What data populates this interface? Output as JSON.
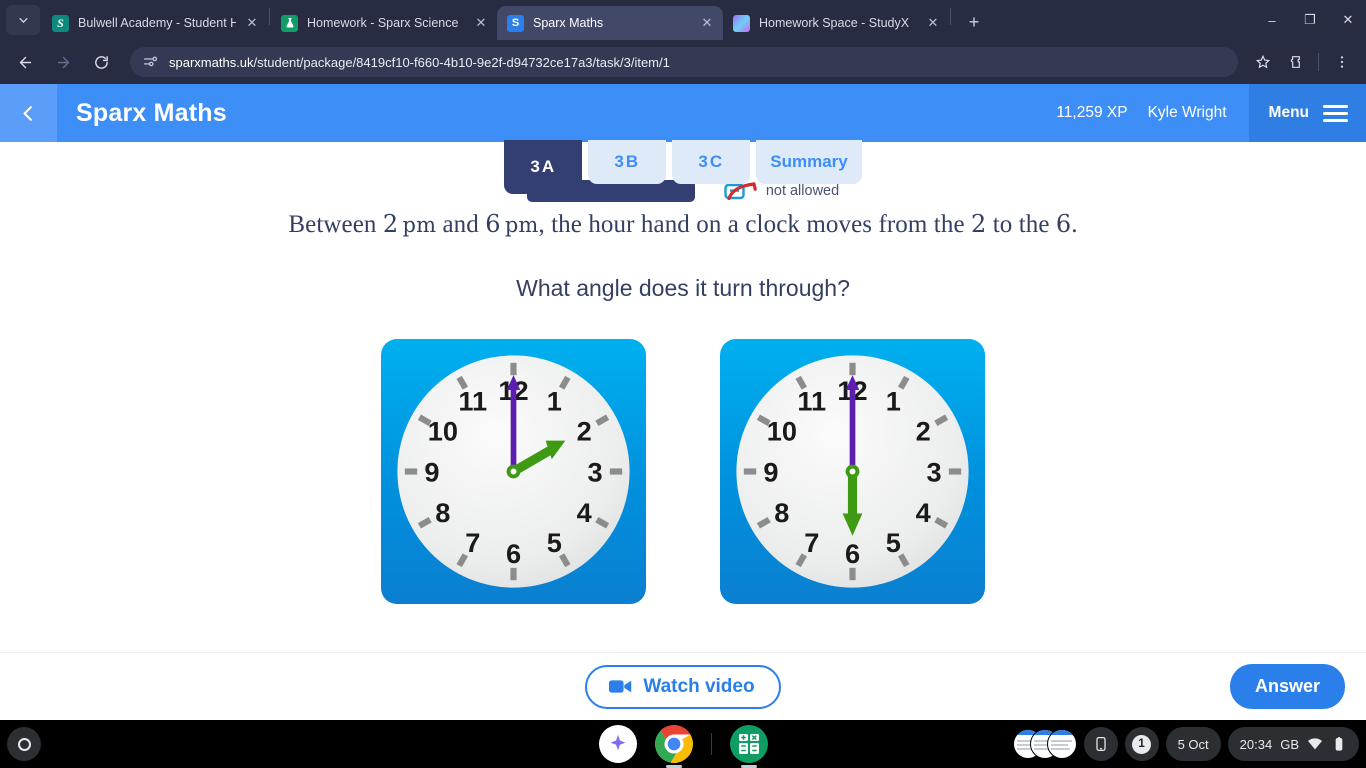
{
  "browser": {
    "tab_list_icon": "chevron-down-icon",
    "tabs": [
      {
        "title": "Bulwell Academy - Student Hom",
        "favicon": "sharepoint-icon",
        "favicon_letter": "S",
        "active": false
      },
      {
        "title": "Homework - Sparx Science",
        "favicon": "flask-icon",
        "favicon_letter": "",
        "active": false
      },
      {
        "title": "Sparx Maths",
        "favicon": "sparx-maths-icon",
        "favicon_letter": "S",
        "active": true
      },
      {
        "title": "Homework Space - StudyX",
        "favicon": "studyx-cube-icon",
        "favicon_letter": "",
        "active": false
      }
    ],
    "new_tab_label": "+",
    "window_controls": {
      "minimize": "–",
      "maximize": "❐",
      "close": "✕"
    },
    "toolbar": {
      "back_icon": "arrow-left-icon",
      "forward_icon": "arrow-right-icon",
      "reload_icon": "reload-icon",
      "site_info_icon": "site-settings-icon",
      "url_host": "sparxmaths.uk",
      "url_path": "/student/package/8419cf10-f660-4b10-9e2f-d94732ce17a3/task/3/item/1",
      "bookmark_icon": "star-icon",
      "extensions_icon": "puzzle-piece-icon",
      "menu_icon": "three-dot-menu-icon"
    }
  },
  "sparx": {
    "back_icon": "chevron-left-icon",
    "title": "Sparx Maths",
    "xp": "11,259 XP",
    "user": "Kyle Wright",
    "menu_label": "Menu",
    "menu_icon": "hamburger-icon",
    "tabs": [
      {
        "label": "3A",
        "active": true
      },
      {
        "label": "3B",
        "active": false
      },
      {
        "label": "3C",
        "active": false
      },
      {
        "label": "Summary",
        "active": false
      }
    ],
    "calculator_icon": "calculator-not-allowed-icon",
    "calculator_note": "not allowed",
    "question": {
      "line1_parts": [
        {
          "text": "Between ",
          "type": "text"
        },
        {
          "text": "2",
          "type": "num"
        },
        {
          "text": " pm",
          "type": "op"
        },
        {
          "text": " and ",
          "type": "text"
        },
        {
          "text": "6",
          "type": "num"
        },
        {
          "text": " pm",
          "type": "op"
        },
        {
          "text": ", the hour hand on a clock moves from the ",
          "type": "text"
        },
        {
          "text": "2",
          "type": "num"
        },
        {
          "text": " to the ",
          "type": "text"
        },
        {
          "text": "6",
          "type": "num"
        },
        {
          "text": ".",
          "type": "text"
        }
      ],
      "line1_plain": "Between 2 pm and 6 pm, the hour hand on a clock moves from the 2 to the 6.",
      "line2": "What angle does it turn through?"
    },
    "clocks": [
      {
        "name": "clock-2-oclock",
        "hour_hand_hour": 2,
        "minute_hand_minute": 0,
        "hour_hand_color": "#3f9a13",
        "minute_hand_color": "#5c1eb0"
      },
      {
        "name": "clock-6-oclock",
        "hour_hand_hour": 6,
        "minute_hand_minute": 0,
        "hour_hand_color": "#3f9a13",
        "minute_hand_color": "#5c1eb0"
      }
    ],
    "clock_numerals": [
      "12",
      "1",
      "2",
      "3",
      "4",
      "5",
      "6",
      "7",
      "8",
      "9",
      "10",
      "11"
    ],
    "footer": {
      "watch_video_label": "Watch video",
      "watch_video_icon": "video-camera-icon",
      "answer_label": "Answer"
    },
    "colors": {
      "header_blue": "#3d8ef7",
      "menu_blue": "#2f7ee4",
      "tab_active_navy": "#333f73",
      "tab_inactive": "#dfeaf9",
      "accent_blue": "#2a7fea",
      "text_navy": "#333f63",
      "clock_bg_top": "#00b0ef",
      "clock_bg_bottom": "#0b7fd0"
    }
  },
  "shelf": {
    "launcher_icon": "launcher-circle-icon",
    "apps": [
      {
        "name": "gemini-app-icon",
        "running": false
      },
      {
        "name": "chrome-app-icon",
        "running": true
      },
      {
        "name": "calculator-app-icon",
        "running": true
      }
    ],
    "tray": {
      "window_previews_icon": "window-previews-icon",
      "phone_hub_icon": "phone-hub-icon",
      "notification_count": "1",
      "date": "5 Oct",
      "time": "20:34",
      "locale": "GB",
      "wifi_icon": "wifi-icon",
      "battery_icon": "battery-icon"
    }
  }
}
